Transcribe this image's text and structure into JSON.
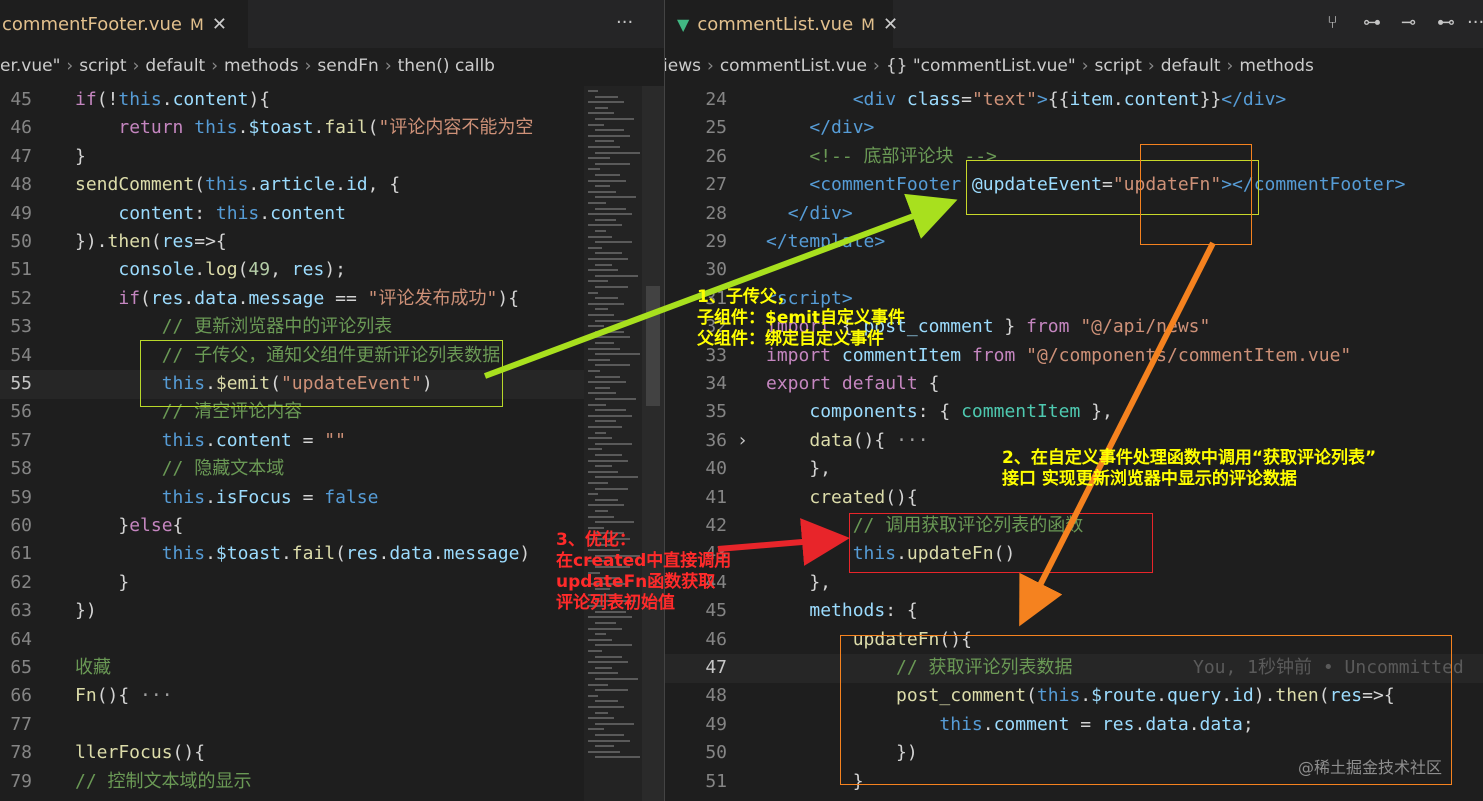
{
  "left_pane": {
    "tab": {
      "filename": "commentFooter.vue",
      "modified": "M",
      "close": "✕"
    },
    "actions": "···",
    "breadcrumb": [
      "er.vue\"",
      "script",
      "default",
      "methods",
      "sendFn",
      "then() callb"
    ],
    "lines": [
      {
        "n": "45",
        "h": "<span class='k'>if</span>(!<span class='b'>this</span>.<span class='v'>content</span>){"
      },
      {
        "n": "46",
        "h": "    <span class='k'>return</span> <span class='b'>this</span>.<span class='v'>$toast</span>.<span class='f'>fail</span>(<span class='s'>\"评论内容不能为空</span>"
      },
      {
        "n": "47",
        "h": "}"
      },
      {
        "n": "48",
        "h": "<span class='f'>sendComment</span>(<span class='b'>this</span>.<span class='v'>article</span>.<span class='v'>id</span>, {"
      },
      {
        "n": "49",
        "h": "    <span class='v'>content</span>: <span class='b'>this</span>.<span class='v'>content</span>"
      },
      {
        "n": "50",
        "h": "}).<span class='f'>then</span>(<span class='v'>res</span>=>{"
      },
      {
        "n": "51",
        "h": "    <span class='v'>console</span>.<span class='f'>log</span>(<span class='n'>49</span>, <span class='v'>res</span>);"
      },
      {
        "n": "52",
        "h": "    <span class='k'>if</span>(<span class='v'>res</span>.<span class='v'>data</span>.<span class='v'>message</span> == <span class='s'>\"评论发布成功\"</span>){"
      },
      {
        "n": "53",
        "h": "        <span class='c'>// 更新浏览器中的评论列表</span>"
      },
      {
        "n": "54",
        "h": "        <span class='c'>// 子传父，通知父组件更新评论列表数据</span>"
      },
      {
        "n": "55",
        "h": "        <span class='b'>this</span>.<span class='f'>$emit</span>(<span class='s'>\"updateEvent\"</span>)",
        "active": true
      },
      {
        "n": "56",
        "h": "        <span class='c'>// 清空评论内容</span>"
      },
      {
        "n": "57",
        "h": "        <span class='b'>this</span>.<span class='v'>content</span> = <span class='s'>\"\"</span>"
      },
      {
        "n": "58",
        "h": "        <span class='c'>// 隐藏文本域</span>"
      },
      {
        "n": "59",
        "h": "        <span class='b'>this</span>.<span class='v'>isFocus</span> = <span class='b'>false</span>"
      },
      {
        "n": "60",
        "h": "    }<span class='k'>else</span>{"
      },
      {
        "n": "61",
        "h": "        <span class='b'>this</span>.<span class='v'>$toast</span>.<span class='f'>fail</span>(<span class='v'>res</span>.<span class='v'>data</span>.<span class='v'>message</span>)"
      },
      {
        "n": "62",
        "h": "    }"
      },
      {
        "n": "63",
        "h": "})"
      },
      {
        "n": "64",
        "h": ""
      },
      {
        "n": "65",
        "h": "<span class='c'>收藏</span>"
      },
      {
        "n": "66",
        "h": "<span class='f'>Fn</span>(){ <span style='color:#9e9e9e'>···</span>"
      },
      {
        "n": "77",
        "h": ""
      },
      {
        "n": "78",
        "h": "<span class='f'>llerFocus</span>(){"
      },
      {
        "n": "79",
        "h": "<span class='c'>// 控制文本域的显示</span>"
      }
    ]
  },
  "right_pane": {
    "tab": {
      "filename": "commentList.vue",
      "modified": "M",
      "close": "✕"
    },
    "actions": [
      "⑂",
      "⊶",
      "⊸",
      "⊷",
      "···"
    ],
    "breadcrumb": [
      "views",
      "commentList.vue",
      "{} \"commentList.vue\"",
      "script",
      "default",
      "methods"
    ],
    "lines": [
      {
        "n": "24",
        "h": "        <span class='t'>&lt;div</span> <span class='v'>class</span>=<span class='s'>\"text\"</span><span class='t'>&gt;</span>{{<span class='v'>item</span>.<span class='v'>content</span>}}<span class='t'>&lt;/div&gt;</span>"
      },
      {
        "n": "25",
        "h": "    <span class='t'>&lt;/div&gt;</span>"
      },
      {
        "n": "26",
        "h": "    <span class='c'>&lt;!-- 底部评论块 --&gt;</span>"
      },
      {
        "n": "27",
        "h": "    <span class='t'>&lt;commentFooter</span> <span class='v'>@updateEvent</span>=<span class='s'>\"updateFn\"</span><span class='t'>&gt;&lt;/commentFooter&gt;</span>"
      },
      {
        "n": "28",
        "h": "  <span class='t'>&lt;/div&gt;</span>"
      },
      {
        "n": "29",
        "h": "<span class='t'>&lt;/template&gt;</span>"
      },
      {
        "n": "30",
        "h": ""
      },
      {
        "n": "31",
        "h": "<span class='t'>&lt;script&gt;</span>"
      },
      {
        "n": "32",
        "h": "<span class='k'>import</span> { <span class='v'>post_comment</span> } <span class='k'>from</span> <span class='s'>\"@/api/news\"</span>"
      },
      {
        "n": "33",
        "h": "<span class='k'>import</span> <span class='v'>commentItem</span> <span class='k'>from</span> <span class='s'>\"@/components/commentItem.vue\"</span>"
      },
      {
        "n": "34",
        "h": "<span class='k'>export</span> <span class='k'>default</span> {"
      },
      {
        "n": "35",
        "h": "    <span class='v'>components</span>: { <span class='v' style='color:#4ec9b0'>commentItem</span> },"
      },
      {
        "n": "36",
        "h": "    <span class='f'>data</span>(){ <span style='color:#9e9e9e'>···</span>",
        "fold": true
      },
      {
        "n": "40",
        "h": "    },"
      },
      {
        "n": "41",
        "h": "    <span class='f'>created</span>(){"
      },
      {
        "n": "42",
        "h": "        <span class='c'>// 调用获取评论列表的函数</span>"
      },
      {
        "n": "43",
        "h": "        <span class='b'>this</span>.<span class='f'>updateFn</span>()"
      },
      {
        "n": "44",
        "h": "    },"
      },
      {
        "n": "45",
        "h": "    <span class='v'>methods</span>: {"
      },
      {
        "n": "46",
        "h": "        <span class='f'>updateFn</span>(){"
      },
      {
        "n": "47",
        "h": "            <span class='c'>// 获取评论列表数据</span>",
        "active": true,
        "blame": "You, 1秒钟前 • Uncommitted"
      },
      {
        "n": "48",
        "h": "            <span class='f'>post_comment</span>(<span class='b'>this</span>.<span class='v'>$route</span>.<span class='v'>query</span>.<span class='v'>id</span>).<span class='f'>then</span>(<span class='v'>res</span>=>{"
      },
      {
        "n": "49",
        "h": "                <span class='b'>this</span>.<span class='v'>comment</span> = <span class='v'>res</span>.<span class='v'>data</span>.<span class='v'>data</span>;"
      },
      {
        "n": "50",
        "h": "            })"
      },
      {
        "n": "51",
        "h": "        }"
      }
    ]
  },
  "annotations": {
    "a1": "1、子传父，\n子组件：$emit自定义事件\n父组件：绑定自定义事件",
    "a2": "2、在自定义事件处理函数中调用“获取评论列表”\n接口 实现更新浏览器中显示的评论数据",
    "a3": "3、优化：\n在created中直接调用\nupdateFn函数获取\n评论列表初始值"
  },
  "watermark": "@稀土掘金技术社区",
  "colors": {
    "green_arrow": "#a8e01e",
    "orange_arrow": "#f5821f",
    "red_arrow": "#e8252a",
    "annot_yellow": "#ffff00",
    "annot_red": "#ff2a2a"
  }
}
